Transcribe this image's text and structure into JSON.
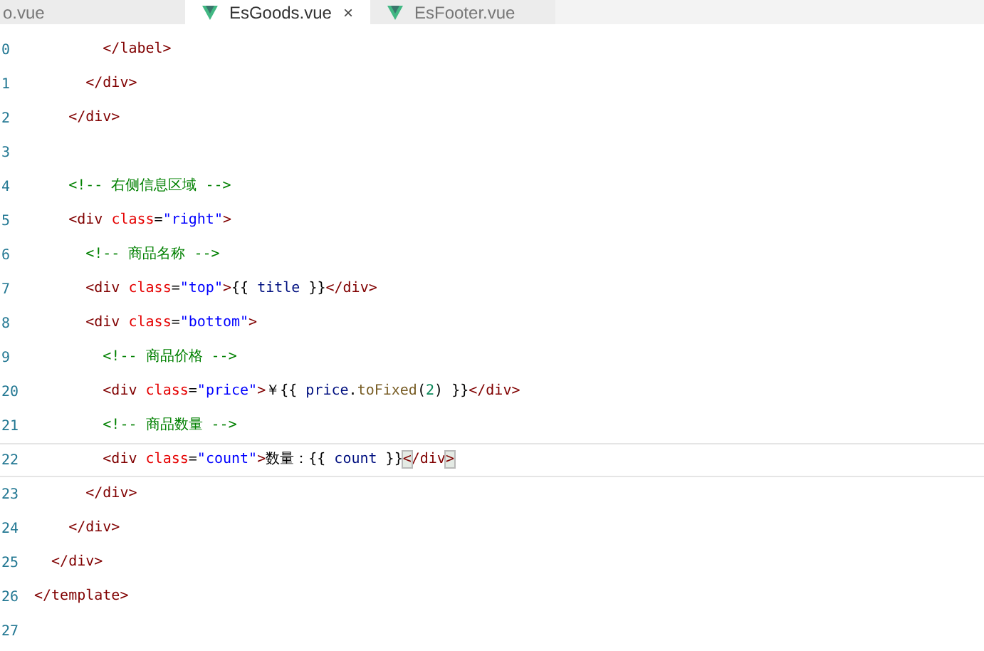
{
  "tabs": [
    {
      "label": "o.vue",
      "selected": false,
      "icon": false
    },
    {
      "label": "EsGoods.vue",
      "selected": true,
      "icon": true,
      "close": "×"
    },
    {
      "label": "EsFooter.vue",
      "selected": false,
      "icon": true
    }
  ],
  "lines": [
    {
      "number": "0",
      "current": false,
      "tokens": [
        {
          "kind": "tag",
          "text": "        </label>"
        }
      ]
    },
    {
      "number": "1",
      "current": false,
      "tokens": [
        {
          "kind": "tag",
          "text": "      </div>"
        }
      ]
    },
    {
      "number": "2",
      "current": false,
      "tokens": [
        {
          "kind": "tag",
          "text": "    </div>"
        }
      ]
    },
    {
      "number": "3",
      "current": false
    },
    {
      "number": "4",
      "current": false,
      "tokens": [
        {
          "kind": "comment",
          "text": "    <!-- 右侧信息区域 -->"
        }
      ]
    },
    {
      "number": "5",
      "current": false,
      "tokens": [
        {
          "kind": "tag",
          "text": "    <div "
        },
        {
          "kind": "attr",
          "text": "class"
        },
        {
          "kind": "text",
          "text": "="
        },
        {
          "kind": "string",
          "text": "\"right\""
        },
        {
          "kind": "tag",
          "text": ">"
        }
      ]
    },
    {
      "number": "6",
      "current": false,
      "tokens": [
        {
          "kind": "comment",
          "text": "      <!-- 商品名称 -->"
        }
      ]
    },
    {
      "number": "7",
      "current": false,
      "tokens": [
        {
          "kind": "tag",
          "text": "      <div "
        },
        {
          "kind": "attr",
          "text": "class"
        },
        {
          "kind": "text",
          "text": "="
        },
        {
          "kind": "string",
          "text": "\"top\""
        },
        {
          "kind": "tag",
          "text": ">"
        },
        {
          "kind": "text",
          "text": "{{ "
        },
        {
          "kind": "var",
          "text": "title"
        },
        {
          "kind": "text",
          "text": " }}"
        },
        {
          "kind": "tag",
          "text": "</div>"
        }
      ]
    },
    {
      "number": "8",
      "current": false,
      "tokens": [
        {
          "kind": "tag",
          "text": "      <div "
        },
        {
          "kind": "attr",
          "text": "class"
        },
        {
          "kind": "text",
          "text": "="
        },
        {
          "kind": "string",
          "text": "\"bottom\""
        },
        {
          "kind": "tag",
          "text": ">"
        }
      ]
    },
    {
      "number": "9",
      "current": false,
      "tokens": [
        {
          "kind": "comment",
          "text": "        <!-- 商品价格 -->"
        }
      ]
    },
    {
      "number": "20",
      "current": false,
      "tokens": [
        {
          "kind": "tag",
          "text": "        <div "
        },
        {
          "kind": "attr",
          "text": "class"
        },
        {
          "kind": "text",
          "text": "="
        },
        {
          "kind": "string",
          "text": "\"price\""
        },
        {
          "kind": "tag",
          "text": ">"
        },
        {
          "kind": "text",
          "text": "￥{{ "
        },
        {
          "kind": "var",
          "text": "price"
        },
        {
          "kind": "text",
          "text": "."
        },
        {
          "kind": "method",
          "text": "toFixed"
        },
        {
          "kind": "text",
          "text": "("
        },
        {
          "kind": "number",
          "text": "2"
        },
        {
          "kind": "text",
          "text": ") }}"
        },
        {
          "kind": "tag",
          "text": "</div>"
        }
      ]
    },
    {
      "number": "21",
      "current": false,
      "tokens": [
        {
          "kind": "comment",
          "text": "        <!-- 商品数量 -->"
        }
      ]
    },
    {
      "number": "22",
      "current": true,
      "tokens": [
        {
          "kind": "tag",
          "text": "        <div "
        },
        {
          "kind": "attr",
          "text": "class"
        },
        {
          "kind": "text",
          "text": "="
        },
        {
          "kind": "string",
          "text": "\"count\""
        },
        {
          "kind": "tag",
          "text": ">"
        },
        {
          "kind": "text",
          "text": "数量：{{ "
        },
        {
          "kind": "var",
          "text": "count"
        },
        {
          "kind": "text",
          "text": " }}"
        },
        {
          "kind": "bracket",
          "text": "<"
        },
        {
          "kind": "tag",
          "text": "/div"
        },
        {
          "kind": "bracket",
          "text": ">"
        }
      ]
    },
    {
      "number": "23",
      "current": false,
      "tokens": [
        {
          "kind": "tag",
          "text": "      </div>"
        }
      ]
    },
    {
      "number": "24",
      "current": false,
      "tokens": [
        {
          "kind": "tag",
          "text": "    </div>"
        }
      ]
    },
    {
      "number": "25",
      "current": false,
      "tokens": [
        {
          "kind": "tag",
          "text": "  </div>"
        }
      ]
    },
    {
      "number": "26",
      "current": false,
      "tokens": [
        {
          "kind": "tag",
          "text": "</template>"
        }
      ]
    },
    {
      "number": "27",
      "current": false
    }
  ]
}
